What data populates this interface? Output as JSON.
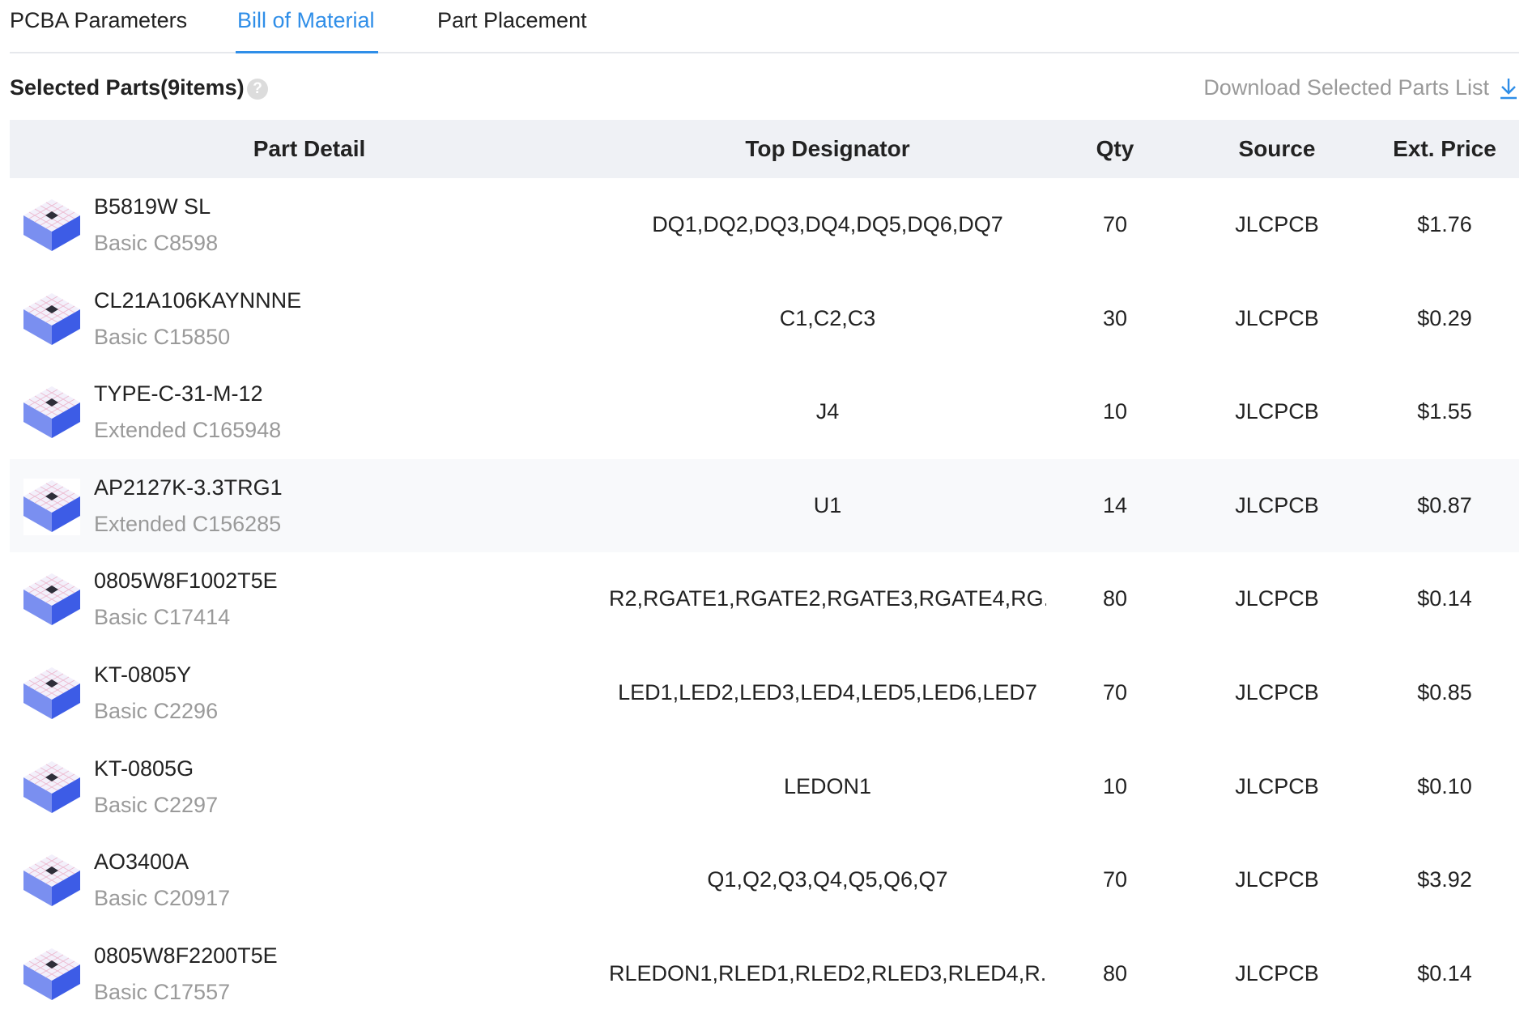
{
  "tabs": [
    {
      "label": "PCBA Parameters",
      "active": false
    },
    {
      "label": "Bill of Material",
      "active": true
    },
    {
      "label": "Part Placement",
      "active": false
    }
  ],
  "section": {
    "title": "Selected Parts(9items)",
    "help_icon": "question-circle-icon",
    "help_glyph": "?",
    "download_label": "Download Selected Parts List",
    "download_icon": "download-arrow-icon"
  },
  "colors": {
    "accent": "#2f8ee8",
    "header_bg": "#eff1f5",
    "muted_text": "#9a9a9a"
  },
  "table": {
    "headers": {
      "part_detail": "Part Detail",
      "top_designator": "Top Designator",
      "qty": "Qty",
      "source": "Source",
      "ext_price": "Ext. Price"
    },
    "rows": [
      {
        "name": "B5819W SL",
        "type": "Basic",
        "code": "C8598",
        "designator": "DQ1,DQ2,DQ3,DQ4,DQ5,DQ6,DQ7",
        "qty": "70",
        "source": "JLCPCB",
        "price": "$1.76",
        "thumb_icon": "sod123-diode-icon"
      },
      {
        "name": "CL21A106KAYNNNE",
        "type": "Basic",
        "code": "C15850",
        "designator": "C1,C2,C3",
        "qty": "30",
        "source": "JLCPCB",
        "price": "$0.29",
        "thumb_icon": "capacitor-chip-icon"
      },
      {
        "name": "TYPE-C-31-M-12",
        "type": "Extended",
        "code": "C165948",
        "designator": "J4",
        "qty": "10",
        "source": "JLCPCB",
        "price": "$1.55",
        "thumb_icon": "usb-c-connector-icon"
      },
      {
        "name": "AP2127K-3.3TRG1",
        "type": "Extended",
        "code": "C156285",
        "designator": "U1",
        "qty": "14",
        "source": "JLCPCB",
        "price": "$0.87",
        "thumb_icon": "sot23-ic-icon"
      },
      {
        "name": "0805W8F1002T5E",
        "type": "Basic",
        "code": "C17414",
        "designator": "R2,RGATE1,RGATE2,RGATE3,RGATE4,RG...",
        "qty": "80",
        "source": "JLCPCB",
        "price": "$0.14",
        "thumb_icon": "resistor-chip-icon"
      },
      {
        "name": "KT-0805Y",
        "type": "Basic",
        "code": "C2296",
        "designator": "LED1,LED2,LED3,LED4,LED5,LED6,LED7",
        "qty": "70",
        "source": "JLCPCB",
        "price": "$0.85",
        "thumb_icon": "led-chip-icon"
      },
      {
        "name": "KT-0805G",
        "type": "Basic",
        "code": "C2297",
        "designator": "LEDON1",
        "qty": "10",
        "source": "JLCPCB",
        "price": "$0.10",
        "thumb_icon": "led-chip-icon"
      },
      {
        "name": "AO3400A",
        "type": "Basic",
        "code": "C20917",
        "designator": "Q1,Q2,Q3,Q4,Q5,Q6,Q7",
        "qty": "70",
        "source": "JLCPCB",
        "price": "$3.92",
        "thumb_icon": "sot23-mosfet-icon"
      },
      {
        "name": "0805W8F2200T5E",
        "type": "Basic",
        "code": "C17557",
        "designator": "RLEDON1,RLED1,RLED2,RLED3,RLED4,R...",
        "qty": "80",
        "source": "JLCPCB",
        "price": "$0.14",
        "thumb_icon": "resistor-chip-icon"
      }
    ]
  }
}
